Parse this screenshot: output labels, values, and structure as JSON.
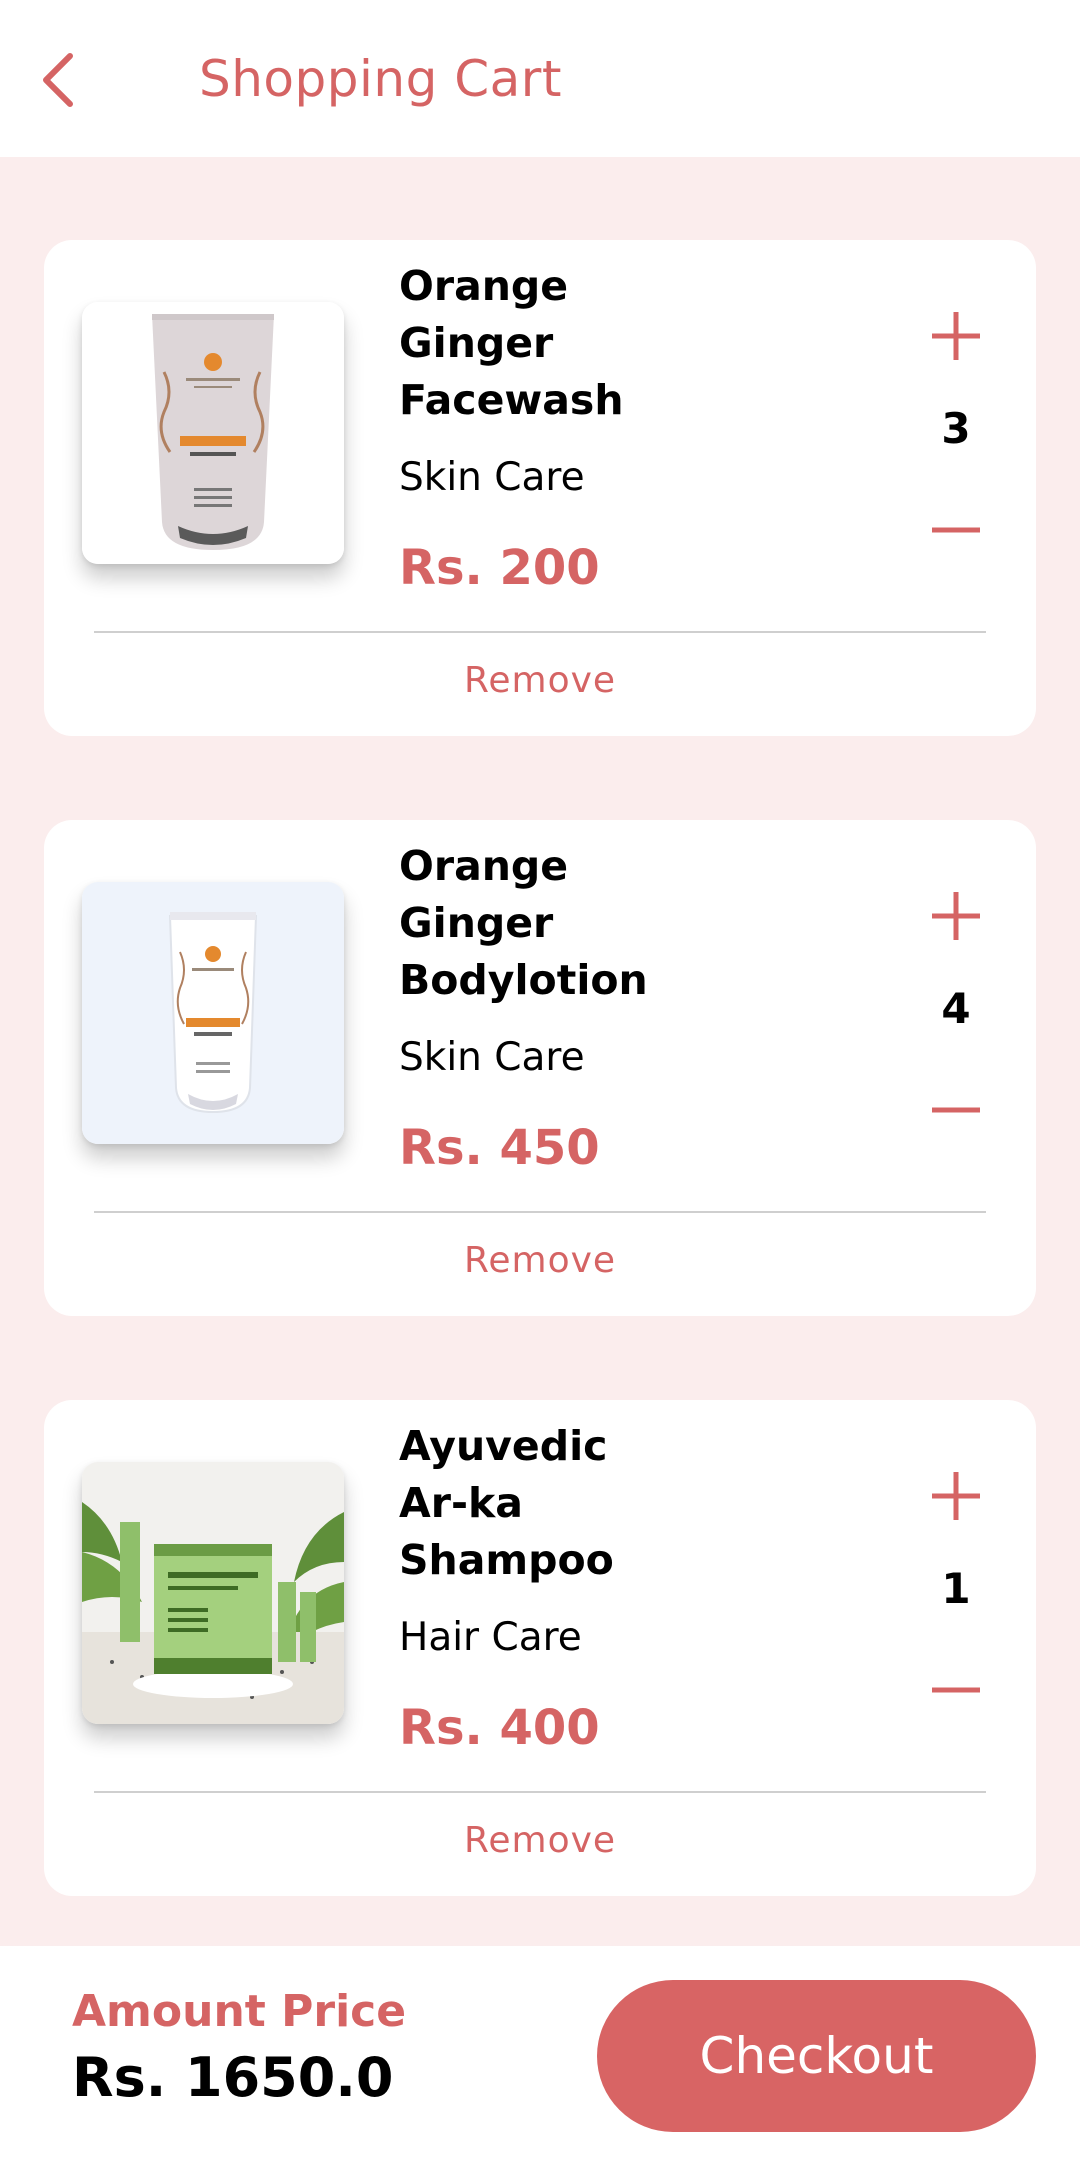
{
  "header": {
    "title": "Shopping Cart",
    "back_icon": "chevron-left-icon"
  },
  "accent_color": "#d56464",
  "cart": {
    "items": [
      {
        "name": "Orange Ginger Facewash",
        "category": "Skin Care",
        "price": "Rs. 200",
        "quantity": "3",
        "remove_label": "Remove",
        "image": "face-wash-tube-image"
      },
      {
        "name": "Orange Ginger Bodylotion",
        "category": "Skin Care",
        "price": "Rs. 450",
        "quantity": "4",
        "remove_label": "Remove",
        "image": "body-lotion-tube-image"
      },
      {
        "name": "Ayuvedic Ar-ka Shampoo",
        "category": "Hair Care",
        "price": "Rs. 400",
        "quantity": "1",
        "remove_label": "Remove",
        "image": "shampoo-pack-image"
      }
    ]
  },
  "summary": {
    "amount_label": "Amount Price",
    "amount_value": "Rs. 1650.0",
    "checkout_label": "Checkout"
  }
}
